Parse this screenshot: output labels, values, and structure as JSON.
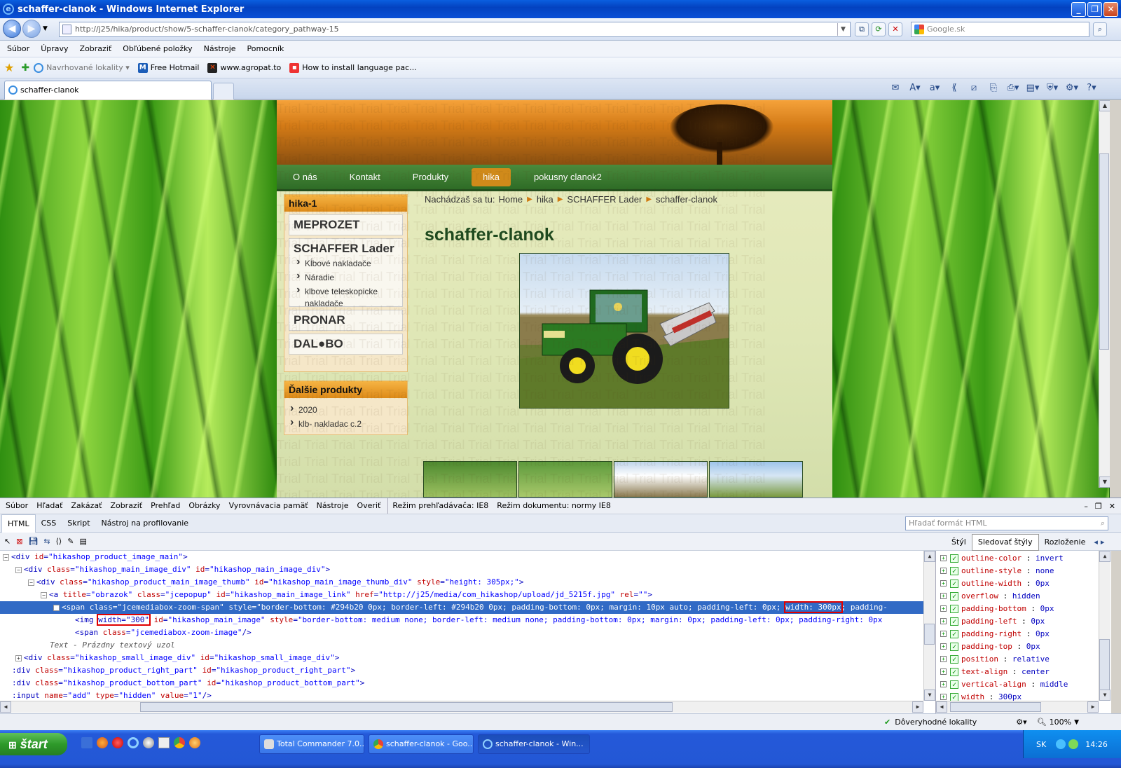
{
  "window": {
    "title": "schaffer-clanok - Windows Internet Explorer",
    "url": "http://j25/hika/product/show/5-schaffer-clanok/category_pathway-15",
    "search_placeholder": "Google.sk"
  },
  "menubar": [
    "Súbor",
    "Úpravy",
    "Zobraziť",
    "Obľúbené položky",
    "Nástroje",
    "Pomocník"
  ],
  "favorites": [
    {
      "label": "Navrhované lokality ▾",
      "icon": "ie-icon"
    },
    {
      "label": "Free Hotmail",
      "icon": "hotmail-icon"
    },
    {
      "label": "www.agropat.to",
      "icon": "agropat-icon"
    },
    {
      "label": "How to install language pac...",
      "icon": "page-icon"
    }
  ],
  "tab": {
    "label": "schaffer-clanok"
  },
  "site": {
    "watermark": "Trial",
    "nav": [
      {
        "label": "O nás",
        "active": false
      },
      {
        "label": "Kontakt",
        "active": false
      },
      {
        "label": "Produkty",
        "active": false
      },
      {
        "label": "hika",
        "active": true
      },
      {
        "label": "pokusny clanok2",
        "active": false
      }
    ],
    "sidebar": {
      "title": "hika-1",
      "categories": [
        {
          "name": "MEPROZET",
          "subs": []
        },
        {
          "name": "SCHAFFER Lader",
          "subs": [
            "Kĺbové nakladače",
            "Náradie",
            "klbove teleskopicke nakladače"
          ]
        },
        {
          "name": "PRONAR",
          "subs": []
        },
        {
          "name": "DAL●BO",
          "subs": []
        }
      ],
      "more_title": "Ďalšie produkty",
      "more_items": [
        "2020",
        "klb- nakladac c.2"
      ]
    },
    "breadcrumb": {
      "prefix": "Nachádzaš sa tu:",
      "items": [
        "Home",
        "hika",
        "SCHAFFER Lader",
        "schaffer-clanok"
      ]
    },
    "page_title": "schaffer-clanok"
  },
  "devtools": {
    "menu": [
      "Súbor",
      "Hľadať",
      "Zakázať",
      "Zobraziť",
      "Prehľad",
      "Obrázky",
      "Vyrovnávacia pamäť",
      "Nástroje",
      "Overiť"
    ],
    "mode_browser": "Režim prehľadávača: IE8",
    "mode_document": "Režim dokumentu: normy IE8",
    "tabs": [
      "HTML",
      "CSS",
      "Skript",
      "Nástroj na profilovanie"
    ],
    "find_placeholder": "Hľadať formát HTML",
    "style_tabs": [
      "Štýl",
      "Sledovať štýly",
      "Rozloženie"
    ],
    "html_lines": [
      {
        "indent": 0,
        "exp": "−",
        "parts": [
          [
            "tg",
            "<div "
          ],
          [
            "an",
            "id"
          ],
          [
            "tg",
            "="
          ],
          [
            "av",
            "\"hikashop_product_image_main\""
          ],
          [
            "tg",
            ">"
          ]
        ]
      },
      {
        "indent": 1,
        "exp": "−",
        "parts": [
          [
            "tg",
            "<div "
          ],
          [
            "an",
            "class"
          ],
          [
            "tg",
            "="
          ],
          [
            "av",
            "\"hikashop_main_image_div\""
          ],
          [
            "tg",
            " "
          ],
          [
            "an",
            "id"
          ],
          [
            "tg",
            "="
          ],
          [
            "av",
            "\"hikashop_main_image_div\""
          ],
          [
            "tg",
            ">"
          ]
        ]
      },
      {
        "indent": 2,
        "exp": "−",
        "parts": [
          [
            "tg",
            "<div "
          ],
          [
            "an",
            "class"
          ],
          [
            "tg",
            "="
          ],
          [
            "av",
            "\"hikashop_product_main_image_thumb\""
          ],
          [
            "tg",
            " "
          ],
          [
            "an",
            "id"
          ],
          [
            "tg",
            "="
          ],
          [
            "av",
            "\"hikashop_main_image_thumb_div\""
          ],
          [
            "tg",
            " "
          ],
          [
            "an",
            "style"
          ],
          [
            "tg",
            "="
          ],
          [
            "av",
            "\"height: 305px;\""
          ],
          [
            "tg",
            ">"
          ]
        ]
      },
      {
        "indent": 3,
        "exp": "−",
        "parts": [
          [
            "tg",
            "<a "
          ],
          [
            "an",
            "title"
          ],
          [
            "tg",
            "="
          ],
          [
            "av",
            "\"obrazok\""
          ],
          [
            "tg",
            " "
          ],
          [
            "an",
            "class"
          ],
          [
            "tg",
            "="
          ],
          [
            "av",
            "\"jcepopup\""
          ],
          [
            "tg",
            " "
          ],
          [
            "an",
            "id"
          ],
          [
            "tg",
            "="
          ],
          [
            "av",
            "\"hikashop_main_image_link\""
          ],
          [
            "tg",
            " "
          ],
          [
            "an",
            "href"
          ],
          [
            "tg",
            "="
          ],
          [
            "av",
            "\"http://j25/media/com_hikashop/upload/jd_5215f.jpg\""
          ],
          [
            "tg",
            " "
          ],
          [
            "an",
            "rel"
          ],
          [
            "tg",
            "="
          ],
          [
            "av",
            "\"\""
          ],
          [
            "tg",
            ">"
          ]
        ]
      },
      {
        "indent": 4,
        "exp": "−",
        "sel": true,
        "parts": [
          [
            "tg",
            "<span class=\"jcemediabox-zoom-span\" style=\"border-bottom: #294b20 0px; border-left: #294b20 0px; padding-bottom: 0px; margin: 10px auto; padding-left: 0px; "
          ],
          [
            "hl",
            "width: 300px"
          ],
          [
            "tg",
            "; padding-"
          ]
        ]
      },
      {
        "indent": 5,
        "exp": "",
        "parts": [
          [
            "tg",
            "<img "
          ],
          [
            "hl",
            "width=\"300\""
          ],
          [
            "tg",
            " "
          ],
          [
            "an",
            "id"
          ],
          [
            "tg",
            "="
          ],
          [
            "av",
            "\"hikashop_main_image\""
          ],
          [
            "tg",
            " "
          ],
          [
            "an",
            "style"
          ],
          [
            "tg",
            "="
          ],
          [
            "av",
            "\"border-bottom: medium none; border-left: medium none; padding-bottom: 0px; margin: 0px; padding-left: 0px; padding-right: 0px"
          ]
        ]
      },
      {
        "indent": 5,
        "exp": "",
        "parts": [
          [
            "tg",
            "<span "
          ],
          [
            "an",
            "class"
          ],
          [
            "tg",
            "="
          ],
          [
            "av",
            "\"jcemediabox-zoom-image\""
          ],
          [
            "tg",
            "/>"
          ]
        ]
      },
      {
        "indent": 3,
        "exp": "",
        "parts": [
          [
            "tx",
            "Text - Prázdny textový uzol"
          ]
        ]
      },
      {
        "indent": 1,
        "exp": "+",
        "parts": [
          [
            "tg",
            "<div "
          ],
          [
            "an",
            "class"
          ],
          [
            "tg",
            "="
          ],
          [
            "av",
            "\"hikashop_small_image_div\""
          ],
          [
            "tg",
            " "
          ],
          [
            "an",
            "id"
          ],
          [
            "tg",
            "="
          ],
          [
            "av",
            "\"hikashop_small_image_div\""
          ],
          [
            "tg",
            ">"
          ]
        ]
      },
      {
        "indent": 0,
        "exp": "",
        "parts": [
          [
            "tg",
            ":div "
          ],
          [
            "an",
            "class"
          ],
          [
            "tg",
            "="
          ],
          [
            "av",
            "\"hikashop_product_right_part\""
          ],
          [
            "tg",
            " "
          ],
          [
            "an",
            "id"
          ],
          [
            "tg",
            "="
          ],
          [
            "av",
            "\"hikashop_product_right_part\""
          ],
          [
            "tg",
            ">"
          ]
        ]
      },
      {
        "indent": 0,
        "exp": "",
        "parts": [
          [
            "tg",
            ":div "
          ],
          [
            "an",
            "class"
          ],
          [
            "tg",
            "="
          ],
          [
            "av",
            "\"hikashop_product_bottom_part\""
          ],
          [
            "tg",
            " "
          ],
          [
            "an",
            "id"
          ],
          [
            "tg",
            "="
          ],
          [
            "av",
            "\"hikashop_product_bottom_part\""
          ],
          [
            "tg",
            ">"
          ]
        ]
      },
      {
        "indent": 0,
        "exp": "",
        "parts": [
          [
            "tg",
            ":input "
          ],
          [
            "an",
            "name"
          ],
          [
            "tg",
            "="
          ],
          [
            "av",
            "\"add\""
          ],
          [
            "tg",
            " "
          ],
          [
            "an",
            "type"
          ],
          [
            "tg",
            "="
          ],
          [
            "av",
            "\"hidden\""
          ],
          [
            "tg",
            " "
          ],
          [
            "an",
            "value"
          ],
          [
            "tg",
            "="
          ],
          [
            "av",
            "\"1\""
          ],
          [
            "tg",
            "/>"
          ]
        ]
      },
      {
        "indent": 0,
        "exp": "",
        "parts": [
          [
            "tx",
            "Text - Prázdny textový uzol"
          ]
        ]
      }
    ],
    "styles": [
      [
        "outline-color",
        "invert"
      ],
      [
        "outline-style",
        "none"
      ],
      [
        "outline-width",
        "0px"
      ],
      [
        "overflow",
        "hidden"
      ],
      [
        "padding-bottom",
        "0px"
      ],
      [
        "padding-left",
        "0px"
      ],
      [
        "padding-right",
        "0px"
      ],
      [
        "padding-top",
        "0px"
      ],
      [
        "position",
        "relative"
      ],
      [
        "text-align",
        "center"
      ],
      [
        "vertical-align",
        "middle"
      ],
      [
        "width",
        "300px"
      ]
    ]
  },
  "status": {
    "zone": "Dôveryhodné lokality",
    "zoom": "100%"
  },
  "taskbar": {
    "start": "štart",
    "tasks": [
      {
        "label": "Total Commander 7.0...",
        "active": false
      },
      {
        "label": "schaffer-clanok - Goo...",
        "active": false
      },
      {
        "label": "schaffer-clanok - Win...",
        "active": true
      }
    ],
    "lang": "SK",
    "clock": "14:26"
  }
}
